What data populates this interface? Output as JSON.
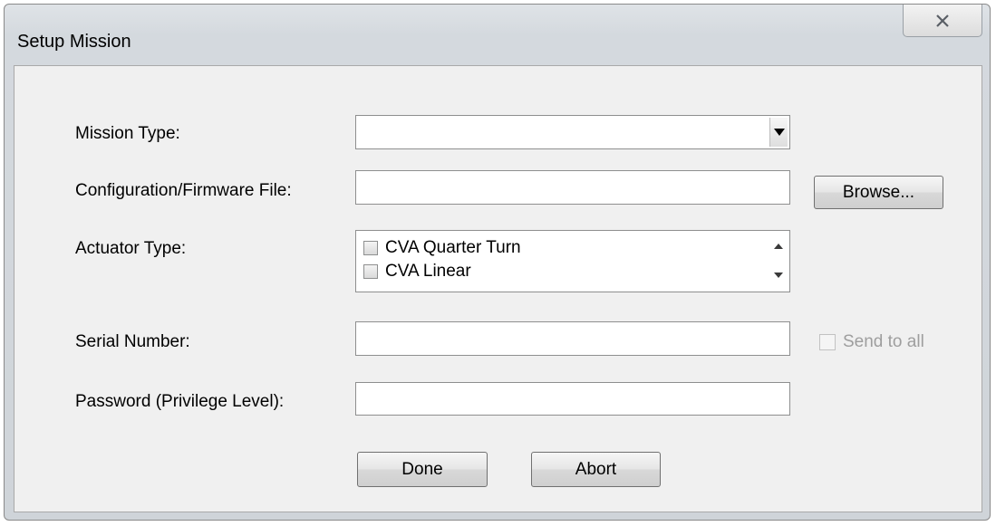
{
  "window": {
    "title": "Setup Mission"
  },
  "form": {
    "mission_type_label": "Mission Type:",
    "mission_type_value": "",
    "config_file_label": "Configuration/Firmware File:",
    "config_file_value": "",
    "browse_label": "Browse...",
    "actuator_type_label": "Actuator Type:",
    "actuator_items": [
      {
        "label": "CVA Quarter Turn",
        "checked": false
      },
      {
        "label": "CVA Linear",
        "checked": false
      }
    ],
    "serial_number_label": "Serial Number:",
    "serial_number_value": "",
    "send_to_all_label": "Send to all",
    "send_to_all_checked": false,
    "password_label": "Password (Privilege Level):",
    "password_value": ""
  },
  "buttons": {
    "done_label": "Done",
    "abort_label": "Abort"
  },
  "icons": {
    "close": "close-icon",
    "dropdown": "triangle-down-icon",
    "scroll_up": "scroll-up-icon",
    "scroll_down": "scroll-down-icon"
  }
}
